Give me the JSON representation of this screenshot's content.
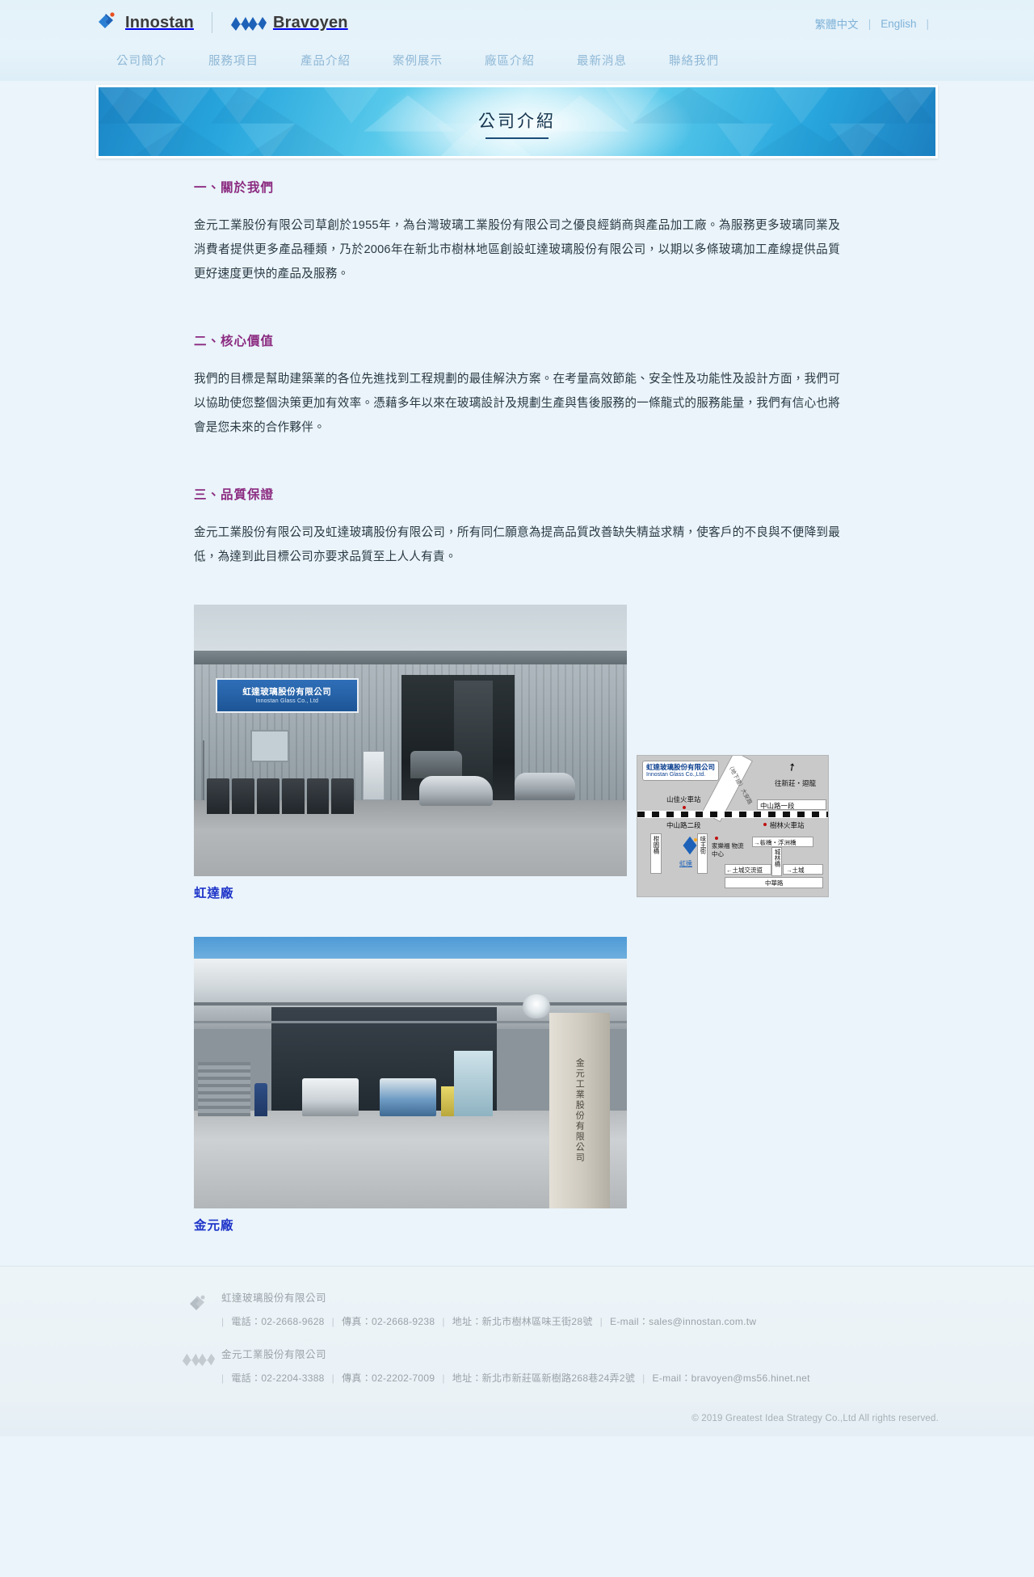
{
  "header": {
    "logos": [
      {
        "name": "Innostan",
        "mark": "innostan-diamond-icon"
      },
      {
        "name": "Bravoyen",
        "mark": "bravoyen-zigzag-icon"
      }
    ],
    "languages": [
      {
        "label": "繁體中文"
      },
      {
        "label": "English"
      }
    ],
    "lang_separator": "|"
  },
  "nav": {
    "items": [
      {
        "label": "公司簡介"
      },
      {
        "label": "服務項目"
      },
      {
        "label": "產品介紹"
      },
      {
        "label": "案例展示"
      },
      {
        "label": "廠區介紹"
      },
      {
        "label": "最新消息"
      },
      {
        "label": "聯絡我們"
      }
    ]
  },
  "banner": {
    "title": "公司介紹"
  },
  "sections": [
    {
      "heading": "一、關於我們",
      "body": "金元工業股份有限公司草創於1955年，為台灣玻璃工業股份有限公司之優良經銷商與產品加工廠。為服務更多玻璃同業及消費者提供更多產品種類，乃於2006年在新北市樹林地區創設虹達玻璃股份有限公司，以期以多條玻璃加工產線提供品質更好速度更快的產品及服務。"
    },
    {
      "heading": "二、核心價值",
      "body": "我們的目標是幫助建築業的各位先進找到工程規劃的最佳解決方案。在考量高效節能、安全性及功能性及設計方面，我們可以協助使您整個決策更加有效率。憑藉多年以來在玻璃設計及規劃生產與售後服務的一條龍式的服務能量，我們有信心也將會是您未來的合作夥伴。"
    },
    {
      "heading": "三、品質保證",
      "body": "金元工業股份有限公司及虹達玻璃股份有限公司，所有同仁願意為提高品質改善缺失精益求精，使客戶的不良與不便降到最低，為達到此目標公司亦要求品質至上人人有責。"
    }
  ],
  "photos": [
    {
      "caption": "虹達廠",
      "sign_zh": "虹達玻璃股份有限公司",
      "sign_en": "Innostan Glass Co., Ltd"
    },
    {
      "caption": "金元廠",
      "pillar_text": "金元工業股份有限公司"
    }
  ],
  "map": {
    "company_zh": "虹達玻璃股份有限公司",
    "company_en": "Innostan Glass Co.,Ltd.",
    "labels": {
      "station_shanjia": "山佳火車站",
      "station_shulin": "樹林火車站",
      "road_zhongshan1": "中山路一段",
      "road_zhongshan2": "中山路二段",
      "road_daan": "（地下道）大安路",
      "to_xinzhuang": "往新莊・迴龍",
      "bridge_ganyuan": "柑園橋",
      "street_weiwang": "味王街",
      "carrefour": "家樂福 物流中心",
      "to_banqiao": "→板橋・浮洲橋",
      "bridge_chenglin": "城林橋",
      "to_tucheng": "→土城",
      "tucheng_interchange": "←土城交流道",
      "road_zhonghua": "中華路",
      "marker": "虹達"
    }
  },
  "footer": {
    "companies": [
      {
        "mark": "innostan-diamond-icon",
        "name": "虹達玻璃股份有限公司",
        "phone_label": "電話：",
        "phone": "02-2668-9628",
        "fax_label": "傳真：",
        "fax": "02-2668-9238",
        "address_label": "地址：",
        "address": "新北市樹林區味王街28號",
        "email_label": "E-mail：",
        "email": "sales@innostan.com.tw"
      },
      {
        "mark": "bravoyen-zigzag-icon",
        "name": "金元工業股份有限公司",
        "phone_label": "電話：",
        "phone": "02-2204-3388",
        "fax_label": "傳真：",
        "fax": "02-2202-7009",
        "address_label": "地址：",
        "address": "新北市新莊區新樹路268巷24弄2號",
        "email_label": "E-mail：",
        "email": "bravoyen@ms56.hinet.net"
      }
    ],
    "copyright": "© 2019 Greatest Idea Strategy Co.,Ltd All rights reserved."
  },
  "colors": {
    "page_bg": "#eaf4fa",
    "nav_link": "#8fb8d6",
    "section_heading": "#8b2a80",
    "caption": "#1f35c9",
    "banner_blue": "#27a9e1",
    "logo_blue": "#1d62b8"
  }
}
